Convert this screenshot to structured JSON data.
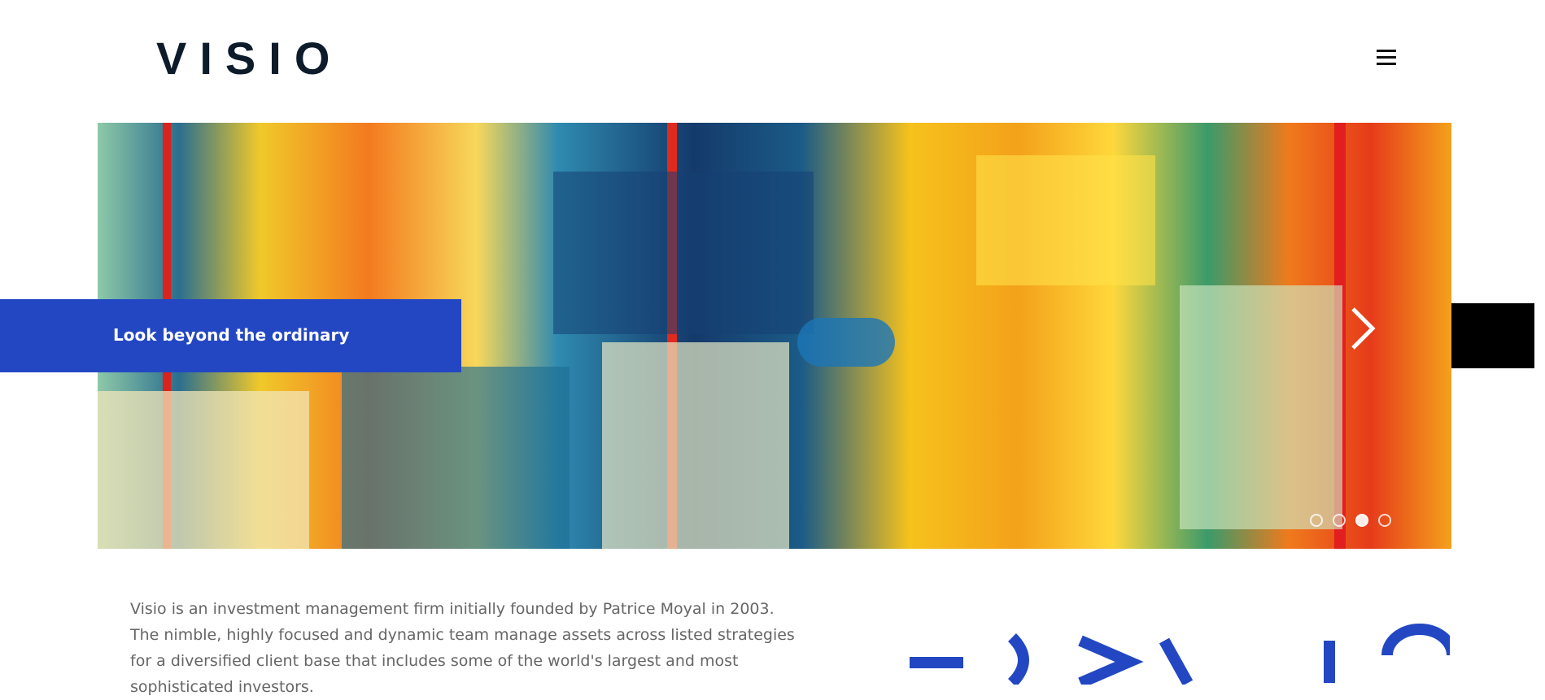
{
  "header": {
    "logo_text": "VISIO",
    "menu_icon": "hamburger-menu-icon"
  },
  "hero": {
    "caption": "Look beyond the ordinary",
    "next_icon": "chevron-right-icon",
    "slides_total": 4,
    "active_slide": 3,
    "colors": {
      "caption_bg": "#2347c3",
      "side_block": "#000000"
    }
  },
  "intro": {
    "text": "Visio is an investment management firm initially founded by Patrice Moyal in 2003. The nimble, highly focused and dynamic team manage assets across listed strategies for a diversified client base that includes some of the world's largest and most sophisticated investors."
  },
  "brand_mark": {
    "color": "#2347c3"
  }
}
